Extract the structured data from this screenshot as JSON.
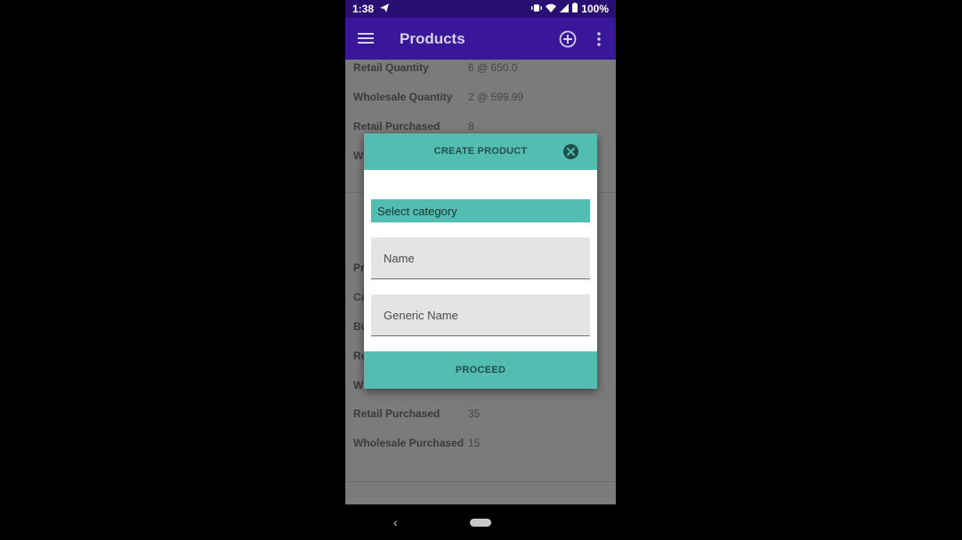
{
  "status_bar": {
    "time": "1:38",
    "battery": "100%"
  },
  "app_bar": {
    "title": "Products"
  },
  "background_list": {
    "rows_top": [
      {
        "key": "Retail Quantity",
        "value": "6 @ 650.0"
      },
      {
        "key": "Wholesale Quantity",
        "value": "2 @ 599.99"
      },
      {
        "key": "Retail Purchased",
        "value": "8"
      }
    ],
    "partial_top": "Wh",
    "partial_labels": [
      "Pr",
      "Ca",
      "Bu",
      "Re",
      "Wh"
    ],
    "rows_bottom": [
      {
        "key": "Retail Purchased",
        "value": "35"
      },
      {
        "key": "Wholesale Purchased",
        "value": "15"
      }
    ]
  },
  "dialog": {
    "title": "CREATE PRODUCT",
    "select_category": "Select category",
    "name_placeholder": "Name",
    "generic_name_placeholder": "Generic Name",
    "proceed": "PROCEED"
  },
  "colors": {
    "status_bar": "#2a0f73",
    "app_bar": "#3a169a",
    "dialog_accent": "#53bdb1",
    "dimmed_background": "#7b7b7b"
  }
}
